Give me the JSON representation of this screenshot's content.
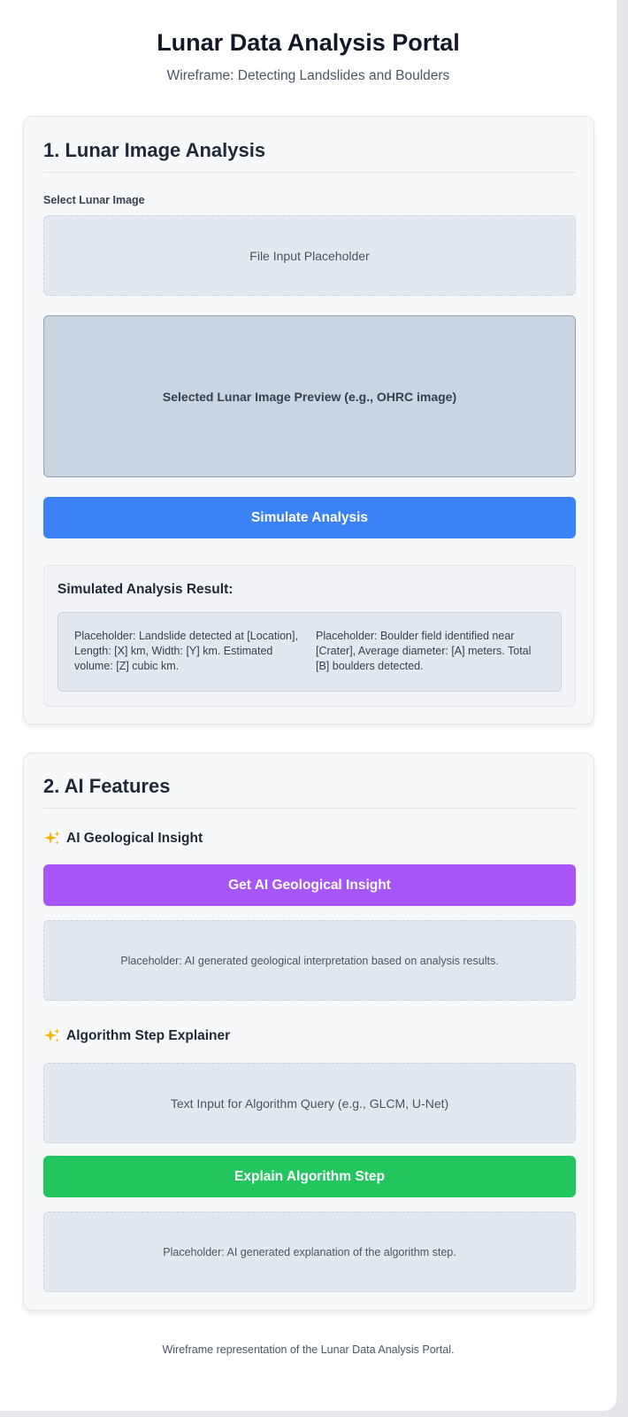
{
  "header": {
    "title": "Lunar Data Analysis Portal",
    "subtitle": "Wireframe: Detecting Landslides and Boulders"
  },
  "image_analysis": {
    "heading": "1. Lunar Image Analysis",
    "select_label": "Select Lunar Image",
    "file_input_placeholder": "File Input Placeholder",
    "preview_text": "Selected Lunar Image Preview (e.g., OHRC image)",
    "simulate_button": "Simulate Analysis",
    "result_title": "Simulated Analysis Result:",
    "result_left": "Placeholder: Landslide detected at [Location], Length: [X] km, Width: [Y] km. Estimated volume: [Z] cubic km.",
    "result_right": "Placeholder: Boulder field identified near [Crater], Average diameter: [A] meters. Total [B] boulders detected."
  },
  "ai_features": {
    "heading": "2. AI Features",
    "insight": {
      "heading": "AI Geological Insight",
      "icon": "sparkles-icon",
      "button": "Get AI Geological Insight",
      "output_placeholder": "Placeholder: AI generated geological interpretation based on analysis results."
    },
    "explainer": {
      "heading": "Algorithm Step Explainer",
      "icon": "sparkles-icon",
      "input_placeholder": "Text Input for Algorithm Query (e.g., GLCM, U-Net)",
      "button": "Explain Algorithm Step",
      "output_placeholder": "Placeholder: AI generated explanation of the algorithm step."
    }
  },
  "footer": {
    "text": "Wireframe representation of the Lunar Data Analysis Portal."
  },
  "colors": {
    "simulate_button": "#3b82f6",
    "insight_button": "#a855f7",
    "explain_button": "#22c55e",
    "sparkle": "#f5b400"
  }
}
